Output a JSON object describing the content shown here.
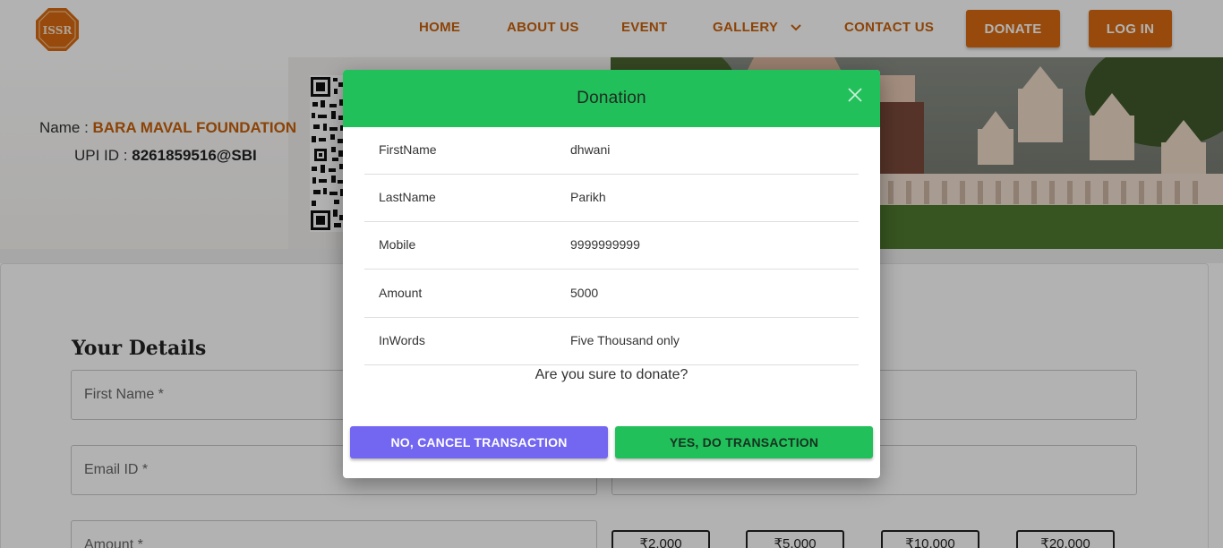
{
  "brand": {
    "logo_text": "ISSR",
    "color": "#d86a10"
  },
  "nav": {
    "links": [
      "HOME",
      "ABOUT US",
      "EVENT",
      "GALLERY",
      "CONTACT US"
    ],
    "donate_label": "DONATE",
    "login_label": "LOG IN"
  },
  "upi": {
    "name_label": "Name :",
    "name_value": "BARA MAVAL FOUNDATION",
    "id_label": "UPI ID :",
    "id_value": "8261859516@SBI"
  },
  "form": {
    "title": "Your Details",
    "first_name_placeholder": "First Name *",
    "email_placeholder": "Email ID *",
    "amount_placeholder": "Amount *",
    "amount_options": [
      "₹2,000",
      "₹5,000",
      "₹10,000",
      "₹20,000"
    ]
  },
  "modal": {
    "title": "Donation",
    "rows": [
      {
        "label": "FirstName",
        "value": "dhwani"
      },
      {
        "label": "LastName",
        "value": "Parikh"
      },
      {
        "label": "Mobile",
        "value": "9999999999"
      },
      {
        "label": "Amount",
        "value": "5000"
      },
      {
        "label": "InWords",
        "value": "Five Thousand only"
      }
    ],
    "confirm_text": "Are you sure to donate?",
    "cancel_label": "NO, CANCEL TRANSACTION",
    "confirm_label": "YES, DO TRANSACTION",
    "header_color": "#22c05b",
    "cancel_color": "#7366f0"
  }
}
